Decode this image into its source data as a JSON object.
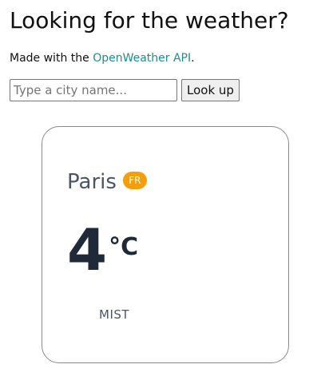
{
  "header": {
    "title": "Looking for the weather?",
    "credit_prefix": "Made with the ",
    "credit_link": "OpenWeather API",
    "credit_suffix": "."
  },
  "search": {
    "placeholder": "Type a city name...",
    "value": "",
    "button_label": "Look up"
  },
  "card": {
    "city": "Paris",
    "country_code": "FR",
    "temperature": "4",
    "unit": "°C",
    "condition": "MIST"
  },
  "colors": {
    "link": "#1e8e8a",
    "badge": "#f59e0b",
    "temperature_text": "#1f2937",
    "muted_text": "#4b5563"
  }
}
